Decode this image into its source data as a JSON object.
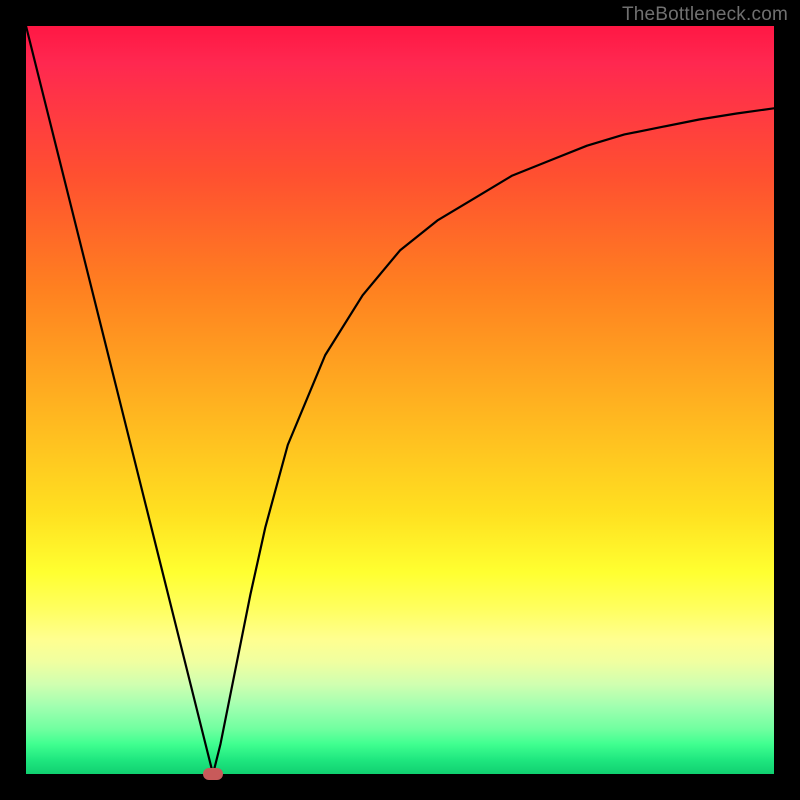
{
  "watermark": "TheBottleneck.com",
  "chart_data": {
    "type": "line",
    "title": "",
    "xlabel": "",
    "ylabel": "",
    "x": [
      0,
      2,
      4,
      6,
      8,
      10,
      12,
      14,
      16,
      18,
      20,
      22,
      24,
      25,
      26,
      28,
      30,
      32,
      35,
      40,
      45,
      50,
      55,
      60,
      65,
      70,
      75,
      80,
      85,
      90,
      95,
      100
    ],
    "values": [
      100,
      92,
      84,
      76,
      68,
      60,
      52,
      44,
      36,
      28,
      20,
      12,
      4,
      0,
      4,
      14,
      24,
      33,
      44,
      56,
      64,
      70,
      74,
      77,
      80,
      82,
      84,
      85.5,
      86.5,
      87.5,
      88.3,
      89
    ],
    "xlim": [
      0,
      100
    ],
    "ylim": [
      0,
      100
    ],
    "marker": {
      "x": 25,
      "y": 0
    },
    "gradient": {
      "top": "#ff1744",
      "bottom": "#10d070",
      "description": "red-orange-yellow-green vertical gradient"
    }
  }
}
